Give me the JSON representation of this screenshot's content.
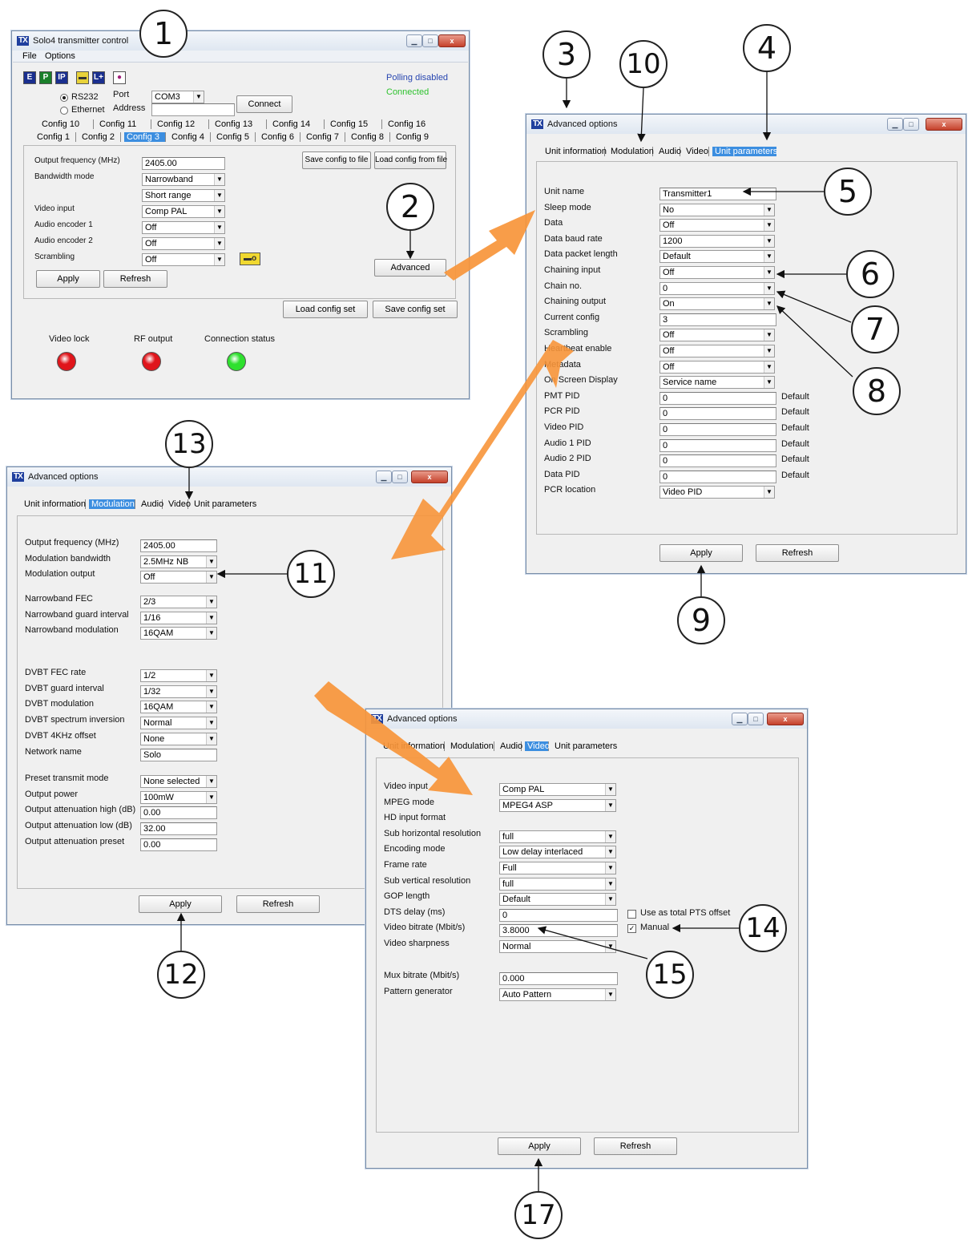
{
  "w1": {
    "title": "Solo4 transmitter control",
    "menu": [
      "File",
      "Options"
    ],
    "status_polling": "Polling disabled",
    "status_connected": "Connected",
    "rs232": "RS232",
    "ethernet": "Ethernet",
    "port_label": "Port",
    "address_label": "Address",
    "port_value": "COM3",
    "connect": "Connect",
    "tabs_row1": [
      "Config 10",
      "Config 11",
      "Config 12",
      "Config 13",
      "Config 14",
      "Config 15",
      "Config 16"
    ],
    "tabs_row2": [
      "Config 1",
      "Config 2",
      "Config 3",
      "Config 4",
      "Config 5",
      "Config 6",
      "Config 7",
      "Config 8",
      "Config 9"
    ],
    "save_cfg_file": "Save config to file",
    "load_cfg_file": "Load config from file",
    "rows": [
      {
        "label": "Output frequency (MHz)",
        "value": "2405.00",
        "kind": "field"
      },
      {
        "label": "Bandwidth mode",
        "value": "Narrowband",
        "kind": "select"
      },
      {
        "label": "",
        "value": "Short range",
        "kind": "select"
      },
      {
        "label": "Video input",
        "value": "Comp PAL",
        "kind": "select"
      },
      {
        "label": "Audio encoder 1",
        "value": "Off",
        "kind": "select"
      },
      {
        "label": "Audio encoder 2",
        "value": "Off",
        "kind": "select"
      },
      {
        "label": "Scrambling",
        "value": "Off",
        "kind": "select"
      }
    ],
    "advanced": "Advanced",
    "apply": "Apply",
    "refresh": "Refresh",
    "load_set": "Load config set",
    "save_set": "Save config set",
    "led_labels": [
      "Video lock",
      "RF output",
      "Connection status"
    ],
    "led_colors": [
      "#e0151b",
      "#e0151b",
      "#2ee02e"
    ]
  },
  "w3": {
    "title": "Advanced options",
    "tabs": [
      "Unit information",
      "Modulation",
      "Audio",
      "Video",
      "Unit parameters"
    ],
    "rows": [
      {
        "label": "Unit name",
        "value": "Transmitter1",
        "kind": "field",
        "extra": ""
      },
      {
        "label": "Sleep mode",
        "value": "No",
        "kind": "select",
        "extra": ""
      },
      {
        "label": "Data",
        "value": "Off",
        "kind": "select",
        "extra": ""
      },
      {
        "label": "Data baud rate",
        "value": "1200",
        "kind": "select",
        "extra": ""
      },
      {
        "label": "Data packet length",
        "value": "Default",
        "kind": "select",
        "extra": ""
      },
      {
        "label": "Chaining input",
        "value": "Off",
        "kind": "select",
        "extra": ""
      },
      {
        "label": "Chain no.",
        "value": "0",
        "kind": "select",
        "extra": ""
      },
      {
        "label": "Chaining output",
        "value": "On",
        "kind": "select",
        "extra": ""
      },
      {
        "label": "Current config",
        "value": "3",
        "kind": "field",
        "extra": ""
      },
      {
        "label": "Scrambling",
        "value": "Off",
        "kind": "select",
        "extra": ""
      },
      {
        "label": "Heartbeat enable",
        "value": "Off",
        "kind": "select",
        "extra": ""
      },
      {
        "label": "Metadata",
        "value": "Off",
        "kind": "select",
        "extra": ""
      },
      {
        "label": "On Screen Display",
        "value": "Service name",
        "kind": "select",
        "extra": ""
      },
      {
        "label": "PMT PID",
        "value": "0",
        "kind": "field",
        "extra": "Default"
      },
      {
        "label": "PCR PID",
        "value": "0",
        "kind": "field",
        "extra": "Default"
      },
      {
        "label": "Video PID",
        "value": "0",
        "kind": "field",
        "extra": "Default"
      },
      {
        "label": "Audio 1 PID",
        "value": "0",
        "kind": "field",
        "extra": "Default"
      },
      {
        "label": "Audio 2 PID",
        "value": "0",
        "kind": "field",
        "extra": "Default"
      },
      {
        "label": "Data PID",
        "value": "0",
        "kind": "field",
        "extra": "Default"
      },
      {
        "label": "PCR location",
        "value": "Video PID",
        "kind": "select",
        "extra": ""
      }
    ],
    "apply": "Apply",
    "refresh": "Refresh"
  },
  "w13": {
    "title": "Advanced options",
    "tabs": [
      "Unit information",
      "Modulation",
      "Audio",
      "Video",
      "Unit parameters"
    ],
    "groups": [
      [
        {
          "label": "Output frequency (MHz)",
          "value": "2405.00",
          "kind": "field"
        },
        {
          "label": "Modulation bandwidth",
          "value": "2.5MHz NB",
          "kind": "select"
        },
        {
          "label": "Modulation output",
          "value": "Off",
          "kind": "select"
        }
      ],
      [
        {
          "label": "Narrowband FEC",
          "value": "2/3",
          "kind": "select"
        },
        {
          "label": "Narrowband guard interval",
          "value": "1/16",
          "kind": "select"
        },
        {
          "label": "Narrowband modulation",
          "value": "16QAM",
          "kind": "select"
        }
      ],
      [
        {
          "label": "DVBT FEC rate",
          "value": "1/2",
          "kind": "select"
        },
        {
          "label": "DVBT guard interval",
          "value": "1/32",
          "kind": "select"
        },
        {
          "label": "DVBT modulation",
          "value": "16QAM",
          "kind": "select"
        },
        {
          "label": "DVBT spectrum inversion",
          "value": "Normal",
          "kind": "select"
        },
        {
          "label": "DVBT 4KHz offset",
          "value": "None",
          "kind": "select"
        },
        {
          "label": "Network name",
          "value": "Solo",
          "kind": "field"
        }
      ],
      [
        {
          "label": "Preset transmit mode",
          "value": "None selected",
          "kind": "select"
        },
        {
          "label": "Output power",
          "value": "100mW",
          "kind": "select"
        },
        {
          "label": "Output attenuation high (dB)",
          "value": "0.00",
          "kind": "field"
        },
        {
          "label": "Output attenuation low (dB)",
          "value": "32.00",
          "kind": "field"
        },
        {
          "label": "Output attenuation preset",
          "value": "0.00",
          "kind": "field"
        }
      ]
    ],
    "apply": "Apply",
    "refresh": "Refresh"
  },
  "wv": {
    "title": "Advanced options",
    "tabs": [
      "Unit information",
      "Modulation",
      "Audio",
      "Video",
      "Unit parameters"
    ],
    "rows": [
      {
        "label": "Video input",
        "value": "Comp PAL",
        "kind": "select"
      },
      {
        "label": "MPEG mode",
        "value": "MPEG4 ASP",
        "kind": "select"
      },
      {
        "label": "HD input format",
        "value": "",
        "kind": "none"
      },
      {
        "label": "Sub horizontal resolution",
        "value": "full",
        "kind": "select"
      },
      {
        "label": "Encoding mode",
        "value": "Low delay interlaced",
        "kind": "select"
      },
      {
        "label": "Frame rate",
        "value": "Full",
        "kind": "select"
      },
      {
        "label": "Sub vertical resolution",
        "value": "full",
        "kind": "select"
      },
      {
        "label": "GOP length",
        "value": "Default",
        "kind": "select"
      },
      {
        "label": "DTS delay (ms)",
        "value": "0",
        "kind": "field"
      },
      {
        "label": "Video bitrate (Mbit/s)",
        "value": "3.8000",
        "kind": "field"
      },
      {
        "label": "Video sharpness",
        "value": "Normal",
        "kind": "select"
      }
    ],
    "rows2": [
      {
        "label": "Mux bitrate (Mbit/s)",
        "value": "0.000",
        "kind": "field"
      },
      {
        "label": "Pattern generator",
        "value": "Auto Pattern",
        "kind": "select"
      }
    ],
    "use_total_pts": "Use as total PTS offset",
    "manual": "Manual",
    "apply": "Apply",
    "refresh": "Refresh"
  },
  "callouts": [
    "1",
    "2",
    "3",
    "10",
    "4",
    "5",
    "6",
    "7",
    "8",
    "9",
    "13",
    "11",
    "12",
    "14",
    "15",
    "17"
  ]
}
